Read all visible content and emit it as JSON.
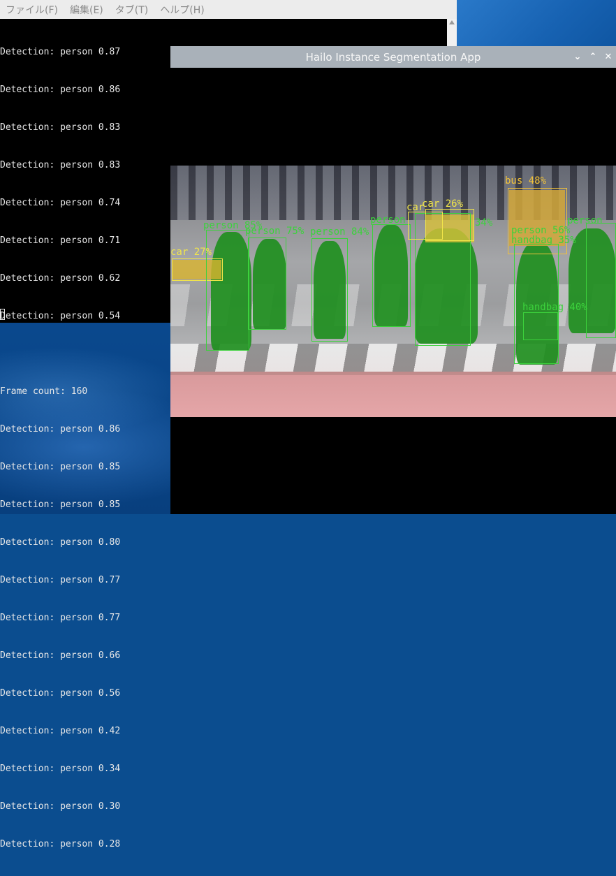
{
  "terminal": {
    "menu": [
      "ファイル(F)",
      "編集(E)",
      "タブ(T)",
      "ヘルプ(H)"
    ],
    "lines": [
      "Detection: person 0.87",
      "Detection: person 0.86",
      "Detection: person 0.83",
      "Detection: person 0.83",
      "Detection: person 0.74",
      "Detection: person 0.71",
      "Detection: person 0.62",
      "Detection: person 0.54",
      "",
      "Frame count: 160",
      "Detection: person 0.86",
      "Detection: person 0.85",
      "Detection: person 0.85",
      "Detection: person 0.80",
      "Detection: person 0.77",
      "Detection: person 0.77",
      "Detection: person 0.66",
      "Detection: person 0.56",
      "Detection: person 0.42",
      "Detection: person 0.34",
      "Detection: person 0.30",
      "Detection: person 0.28"
    ]
  },
  "app": {
    "title": "Hailo Instance Segmentation App",
    "buttons": {
      "minimize": "⌄",
      "maximize": "⌃",
      "close": "✕"
    }
  },
  "detections": [
    {
      "label": "car 27%",
      "color": "#f2e64a"
    },
    {
      "label": "person 85%",
      "color": "#3cd23c"
    },
    {
      "label": "person 75%",
      "color": "#3cd23c"
    },
    {
      "label": "person 84%",
      "color": "#3cd23c"
    },
    {
      "label": "person",
      "color": "#3cd23c"
    },
    {
      "label": "car",
      "color": "#f2e64a"
    },
    {
      "label": "car 26%",
      "color": "#f2e64a"
    },
    {
      "label": "34%",
      "color": "#3cd23c"
    },
    {
      "label": "bus 48%",
      "color": "#f2c23a"
    },
    {
      "label": "person 56%",
      "color": "#3cd23c"
    },
    {
      "label": "handbag 35%",
      "color": "#3cd23c"
    },
    {
      "label": "handbag 40%",
      "color": "#3cd23c"
    },
    {
      "label": "person",
      "color": "#3cd23c"
    }
  ]
}
